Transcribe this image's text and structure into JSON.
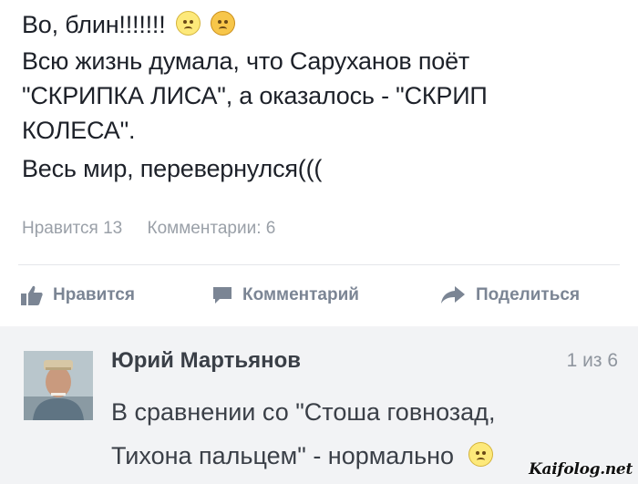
{
  "post": {
    "lines": [
      "Во, блин!!!!!!!",
      "Всю жизнь думала, что Саруханов поёт",
      "\"СКРИПКА ЛИСА\", а оказалось - \"СКРИП",
      "КОЛЕСА\".",
      "Весь мир, перевернулся((("
    ],
    "emoji_icons": [
      "sad-face-emoji-icon",
      "angry-face-emoji-icon"
    ]
  },
  "stats": {
    "likes": "Нравится 13",
    "comments": "Комментарии: 6"
  },
  "actions": {
    "like_label": "Нравится",
    "comment_label": "Комментарий",
    "share_label": "Поделиться",
    "icon_color": "#7b8594"
  },
  "comment": {
    "author": "Юрий Мартьянов",
    "page": "1 из 6",
    "text_line1": "В сравнении со \"Стоша говнозад,",
    "text_line2": "Тихона пальцем\" - нормально",
    "background": "#f2f3f5"
  },
  "watermark": "Kaifolog.net"
}
